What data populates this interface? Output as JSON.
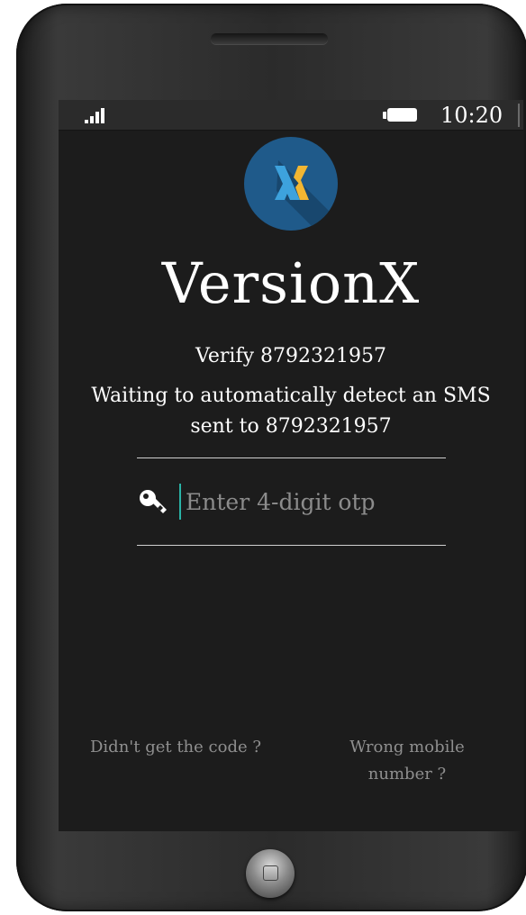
{
  "status_bar": {
    "time": "10:20",
    "signal_icon": "signal-bars-icon",
    "battery_icon": "battery-full-icon"
  },
  "app": {
    "name": "VersionX",
    "logo_icon": "versionx-logo-icon"
  },
  "verification": {
    "title": "Verify 8792321957",
    "message": "Waiting to automatically detect an SMS sent to 8792321957"
  },
  "otp": {
    "value": "",
    "placeholder": "Enter 4-digit otp",
    "icon": "key-icon"
  },
  "links": {
    "resend_label": "Didn't get the code ?",
    "wrong_number_label": "Wrong mobile number ?"
  },
  "colors": {
    "screen_background": "#1c1c1c",
    "logo_background": "#1f5a8a",
    "logo_x_left": "#3da2dd",
    "logo_x_right": "#f2b632",
    "cursor_accent": "#2ab3a6",
    "link_text": "#8f8f8f"
  }
}
